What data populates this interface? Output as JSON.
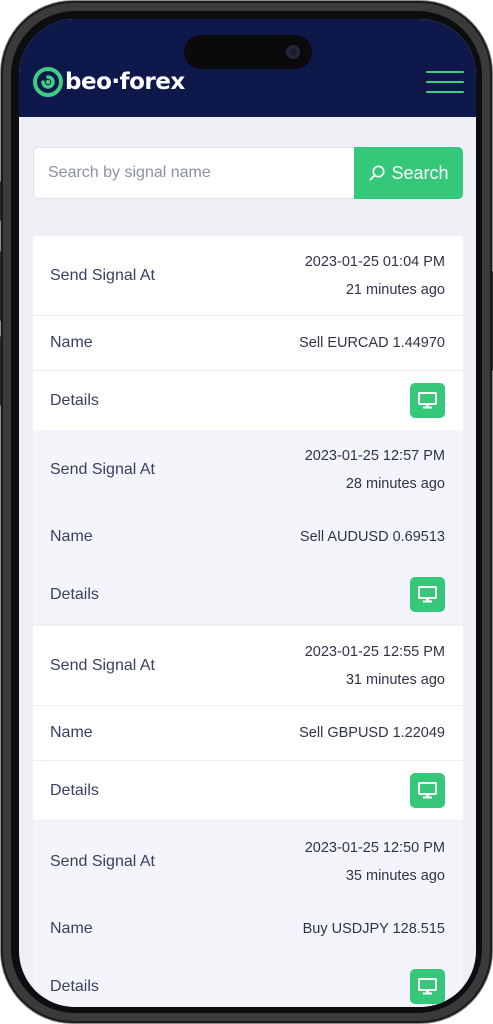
{
  "brand": {
    "name": "beo·forex",
    "accent": "#35c87a",
    "header_bg": "#0f184a"
  },
  "search": {
    "placeholder": "Search by signal name",
    "button_label": "Search"
  },
  "signals": [
    {
      "send_label": "Send Signal At",
      "datetime": "2023-01-25 01:04 PM",
      "ago": "21 minutes ago",
      "name_label": "Name",
      "name": "Sell EURCAD 1.44970",
      "details_label": "Details",
      "details_icon": "monitor-icon"
    },
    {
      "send_label": "Send Signal At",
      "datetime": "2023-01-25 12:57 PM",
      "ago": "28 minutes ago",
      "name_label": "Name",
      "name": "Sell AUDUSD 0.69513",
      "details_label": "Details",
      "details_icon": "monitor-icon"
    },
    {
      "send_label": "Send Signal At",
      "datetime": "2023-01-25 12:55 PM",
      "ago": "31 minutes ago",
      "name_label": "Name",
      "name": "Sell GBPUSD 1.22049",
      "details_label": "Details",
      "details_icon": "monitor-icon"
    },
    {
      "send_label": "Send Signal At",
      "datetime": "2023-01-25 12:50 PM",
      "ago": "35 minutes ago",
      "name_label": "Name",
      "name": "Buy USDJPY 128.515",
      "details_label": "Details",
      "details_icon": "monitor-icon"
    }
  ]
}
